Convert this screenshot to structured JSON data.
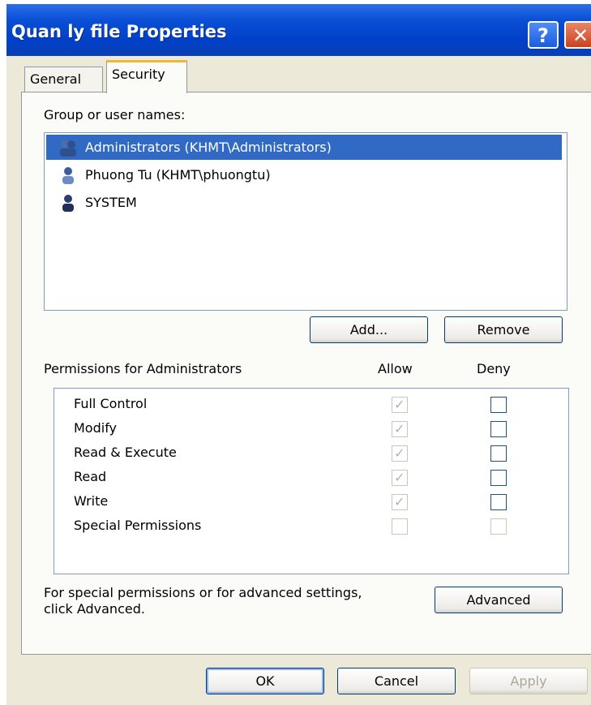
{
  "window": {
    "title": "Quan ly file Properties",
    "help_label": "?",
    "close_label": "✕"
  },
  "tabs": [
    {
      "label": "General",
      "selected": false
    },
    {
      "label": "Security",
      "selected": true
    }
  ],
  "groups": {
    "label": "Group or user names:",
    "users": [
      {
        "name": "Administrators (KHMT\\Administrators)",
        "selected": true,
        "icon": "group-icon"
      },
      {
        "name": "Phuong Tu (KHMT\\phuongtu)",
        "selected": false,
        "icon": "user-icon"
      },
      {
        "name": "SYSTEM",
        "selected": false,
        "icon": "system-user-icon"
      }
    ],
    "add_label": "Add...",
    "remove_label": "Remove"
  },
  "permissions": {
    "label": "Permissions for Administrators",
    "allow_header": "Allow",
    "deny_header": "Deny",
    "rows": [
      {
        "name": "Full Control",
        "allow": true,
        "deny": false,
        "allow_enabled": false,
        "deny_enabled": true
      },
      {
        "name": "Modify",
        "allow": true,
        "deny": false,
        "allow_enabled": false,
        "deny_enabled": true
      },
      {
        "name": "Read & Execute",
        "allow": true,
        "deny": false,
        "allow_enabled": false,
        "deny_enabled": true
      },
      {
        "name": "Read",
        "allow": true,
        "deny": false,
        "allow_enabled": false,
        "deny_enabled": true
      },
      {
        "name": "Write",
        "allow": true,
        "deny": false,
        "allow_enabled": false,
        "deny_enabled": true
      },
      {
        "name": "Special Permissions",
        "allow": false,
        "deny": false,
        "allow_enabled": false,
        "deny_enabled": false
      }
    ]
  },
  "advanced": {
    "text_line1": "For special permissions or for advanced settings,",
    "text_line2": "click Advanced.",
    "button_label": "Advanced"
  },
  "footer": {
    "ok_label": "OK",
    "cancel_label": "Cancel",
    "apply_label": "Apply"
  },
  "colors": {
    "titlebar": "#0a4fd6",
    "selection": "#316ac5",
    "dialog_bg": "#ece9d8"
  }
}
